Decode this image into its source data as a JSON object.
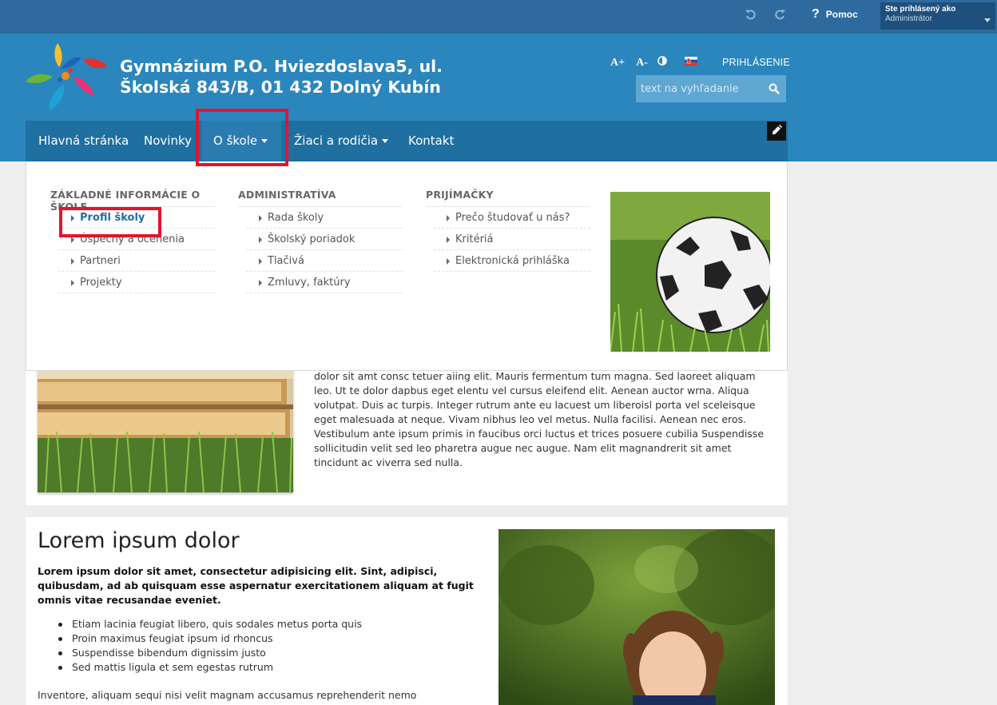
{
  "topbar": {
    "undo_icon": "undo-icon",
    "redo_icon": "redo-icon",
    "help_label": "Pomoc",
    "user_title": "Ste prihlásený ako",
    "user_name": "Administrátor"
  },
  "header": {
    "title_line1": "Gymnázium P.O. Hviezdoslava5, ul.",
    "title_line2": "Školská 843/B, 01 432 Dolný Kubín",
    "font_increase": "A+",
    "font_decrease": "A-",
    "login_label": "PRIHLÁSENIE",
    "search_placeholder": "text na vyhľadanie"
  },
  "nav": {
    "items": [
      {
        "label": "Hlavná stránka"
      },
      {
        "label": "Novinky"
      },
      {
        "label": "O škole"
      },
      {
        "label": "Žiaci a rodičia"
      },
      {
        "label": "Kontakt"
      }
    ]
  },
  "mega_menu": {
    "columns": [
      {
        "title": "ZÁKLADNÉ INFORMÁCIE O ŠKOLE",
        "items": [
          "Profil školy",
          "Úspechy a ocenenia",
          "Partneri",
          "Projekty"
        ]
      },
      {
        "title": "ADMINISTRATÍVA",
        "items": [
          "Rada školy",
          "Školský poriadok",
          "Tlačivá",
          "Zmluvy, faktúry"
        ]
      },
      {
        "title": "PRIJÍMAČKY",
        "items": [
          "Prečo študovať u nás?",
          "Kritériá",
          "Elektronická prihláška"
        ]
      }
    ]
  },
  "content": {
    "paragraph": "dolor sit amt consc tetuer aiing elit. Mauris fermentum tum magna. Sed laoreet aliquam leo. Ut te dolor dapbus eget elentu vel cursus eleifend elit. Aenean auctor wrna. Aliqua volutpat. Duis ac turpis. Integer rutrum ante eu lacuest um liberoisl porta vel sceleisque eget malesuada at neque. Vivam nibhus leo vel metus. Nulla facilisi. Aenean nec eros. Vestibulum ante ipsum primis in faucibus orci luctus et trices posuere cubilia Suspendisse sollicitudin velit sed leo pharetra augue nec augue. Nam elit magnandrerit sit amet tincidunt ac viverra sed nulla.",
    "section_title": "Lorem ipsum dolor",
    "lead": "Lorem ipsum dolor sit amet, consectetur adipisicing elit. Sint, adipisci, quibusdam, ad ab quisquam esse aspernatur exercitationem aliquam at fugit omnis vitae recusandae eveniet.",
    "bullets": [
      "Etiam lacinia feugiat libero, quis sodales metus porta quis",
      "Proin maximus feugiat ipsum id rhoncus",
      "Suspendisse bibendum dignissim justo",
      "Sed mattis ligula et sem egestas rutrum"
    ],
    "tail": "Inventore, aliquam sequi nisi velit magnam accusamus reprehenderit nemo"
  },
  "colors": {
    "topbar": "#2e6a9e",
    "header": "#2a86bd",
    "nav": "#1f6fa0",
    "highlight": "#e3142c"
  }
}
